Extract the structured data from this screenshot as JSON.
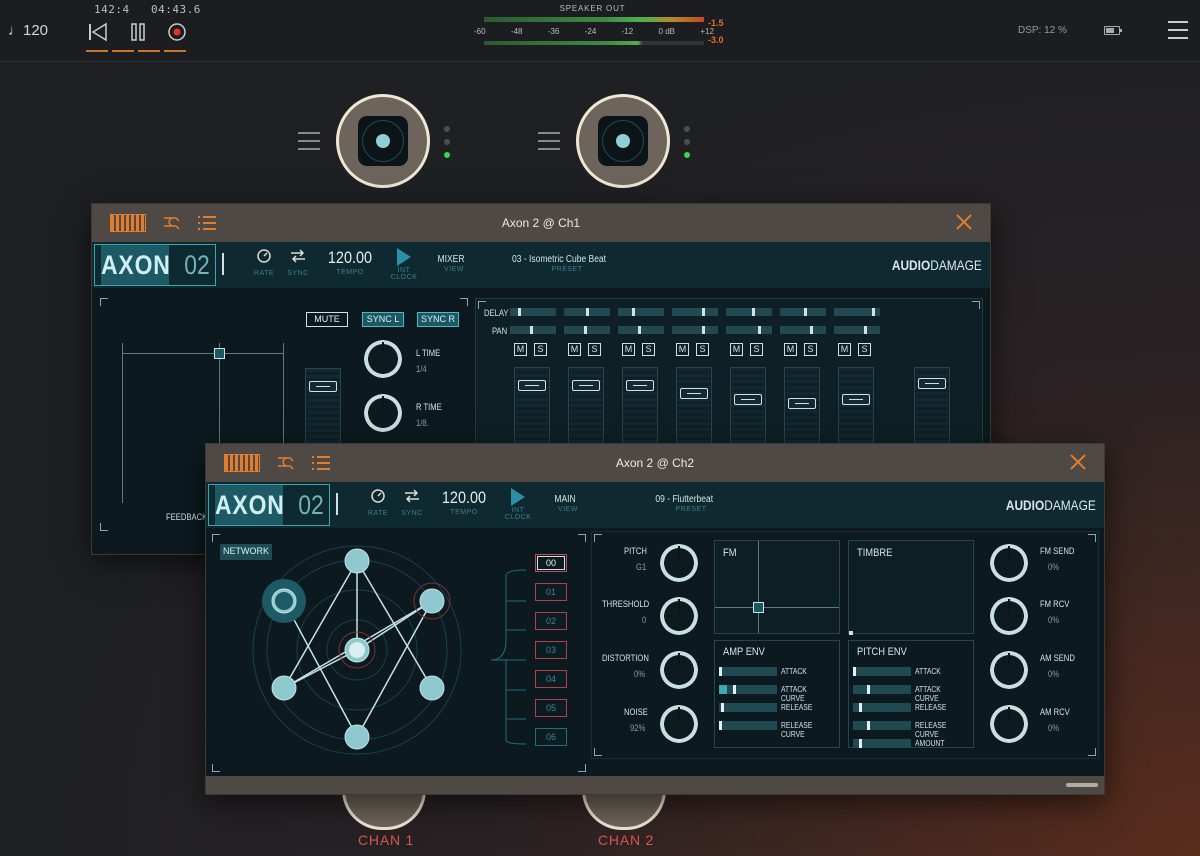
{
  "topbar": {
    "tempo": "♩120",
    "position": "142:4   04:43.6",
    "speaker_out": "SPEAKER OUT",
    "scale": [
      "-60",
      "-48",
      "-36",
      "-24",
      "-12",
      "0 dB",
      "+12"
    ],
    "peak_top": "-1.5",
    "peak_bottom": "-3.0",
    "dsp": "DSP: 12 %"
  },
  "channels": {
    "chan1": "CHAN 1",
    "chan2": "CHAN 2"
  },
  "win1": {
    "title": "Axon 2 @ Ch1",
    "logo_a": "AXON",
    "logo_n": "02",
    "tempo": "120.00",
    "view_value": "MIXER",
    "preset": "03 - Isometric Cube Beat",
    "labels": {
      "rate": "RATE",
      "sync": "SYNC",
      "tempo": "TEMPO",
      "int_clock": "INT CLOCK",
      "view": "VIEW",
      "preset": "PRESET"
    },
    "brand_a": "AUDIO",
    "brand_b": "DAMAGE",
    "mute": "MUTE",
    "sync_l": "SYNC L",
    "sync_r": "SYNC R",
    "l_time": "L TIME",
    "l_time_val": "1/4",
    "r_time": "R TIME",
    "r_time_val": "1/8.",
    "feedback": "FEEDBACK",
    "delay": "DELAY",
    "pan": "PAN",
    "m": "M",
    "s": "S"
  },
  "win2": {
    "title": "Axon 2 @ Ch2",
    "logo_a": "AXON",
    "logo_n": "02",
    "tempo": "120.00",
    "view_value": "MAIN",
    "preset": "09 - Flutterbeat",
    "labels": {
      "rate": "RATE",
      "sync": "SYNC",
      "tempo": "TEMPO",
      "int_clock": "INT CLOCK",
      "view": "VIEW",
      "preset": "PRESET"
    },
    "brand_a": "AUDIO",
    "brand_b": "DAMAGE",
    "network": "NETWORK",
    "slots": [
      "00",
      "01",
      "02",
      "03",
      "04",
      "05",
      "06"
    ],
    "pitch": "PITCH",
    "pitch_val": "G1",
    "threshold": "THRESHOLD",
    "threshold_val": "0",
    "distortion": "DISTORTION",
    "distortion_val": "0%",
    "noise": "NOISE",
    "noise_val": "92%",
    "fm": "FM",
    "timbre": "TIMBRE",
    "amp_env": "AMP ENV",
    "pitch_env": "PITCH ENV",
    "amp_env_params": [
      "ATTACK",
      "ATTACK CURVE",
      "RELEASE",
      "RELEASE CURVE"
    ],
    "pitch_env_params": [
      "ATTACK",
      "ATTACK CURVE",
      "RELEASE",
      "RELEASE CURVE",
      "AMOUNT"
    ],
    "fm_send": "FM SEND",
    "fm_send_val": "0%",
    "fm_rcv": "FM RCV",
    "fm_rcv_val": "0%",
    "am_send": "AM SEND",
    "am_send_val": "0%",
    "am_rcv": "AM RCV",
    "am_rcv_val": "0%"
  },
  "colors": {
    "accent_orange": "#e27d2c",
    "teal": "#3aa6b0",
    "chan_red": "#d8584a",
    "led_green": "#3fd14c"
  }
}
